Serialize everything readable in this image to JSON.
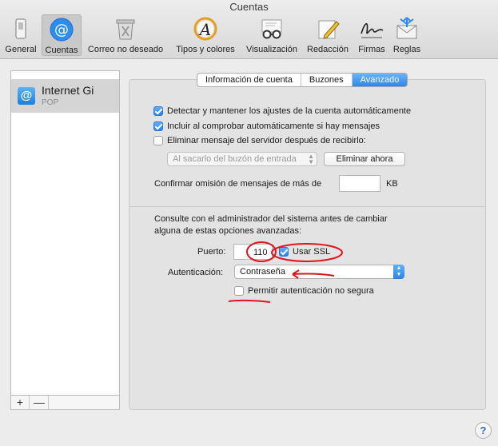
{
  "window": {
    "title": "Cuentas"
  },
  "toolbar": {
    "items": [
      {
        "label": "General",
        "icon": "switch-icon"
      },
      {
        "label": "Cuentas",
        "icon": "at-icon"
      },
      {
        "label": "Correo no deseado",
        "icon": "trash-icon"
      },
      {
        "label": "Tipos y colores",
        "icon": "font-icon"
      },
      {
        "label": "Visualización",
        "icon": "glasses-icon"
      },
      {
        "label": "Redacción",
        "icon": "pencil-icon"
      },
      {
        "label": "Firmas",
        "icon": "signature-icon"
      },
      {
        "label": "Reglas",
        "icon": "rules-icon"
      }
    ],
    "selected": "Cuentas"
  },
  "sidebar": {
    "account": {
      "name": "Internet Gi",
      "type": "POP"
    },
    "add_label": "+",
    "remove_label": "—"
  },
  "tabs": [
    {
      "label": "Información de cuenta",
      "active": false
    },
    {
      "label": "Buzones",
      "active": false
    },
    {
      "label": "Avanzado",
      "active": true
    }
  ],
  "advanced": {
    "detect_label": "Detectar y mantener los ajustes de la cuenta automáticamente",
    "detect_checked": true,
    "include_label": "Incluir al comprobar automáticamente si hay mensajes",
    "include_checked": true,
    "delete_label": "Eliminar mensaje del servidor después de recibirlo:",
    "delete_checked": false,
    "delete_when_value": "Al sacarlo del buzón de entrada",
    "delete_now_label": "Eliminar ahora",
    "confirm_label": "Confirmar omisión de mensajes de más de",
    "confirm_value": "",
    "confirm_unit": "KB",
    "admin_note_line1": "Consulte con el administrador del sistema antes de cambiar",
    "admin_note_line2": "alguna de estas opciones avanzadas:",
    "port_label": "Puerto:",
    "port_value": "110",
    "ssl_label": "Usar SSL",
    "ssl_checked": true,
    "auth_label": "Autenticación:",
    "auth_value": "Contraseña",
    "insecure_label": "Permitir autenticación no segura",
    "insecure_checked": false
  },
  "help": {
    "label": "?"
  },
  "colors": {
    "accent": "#2a83ee",
    "annotation": "#e0141b"
  }
}
